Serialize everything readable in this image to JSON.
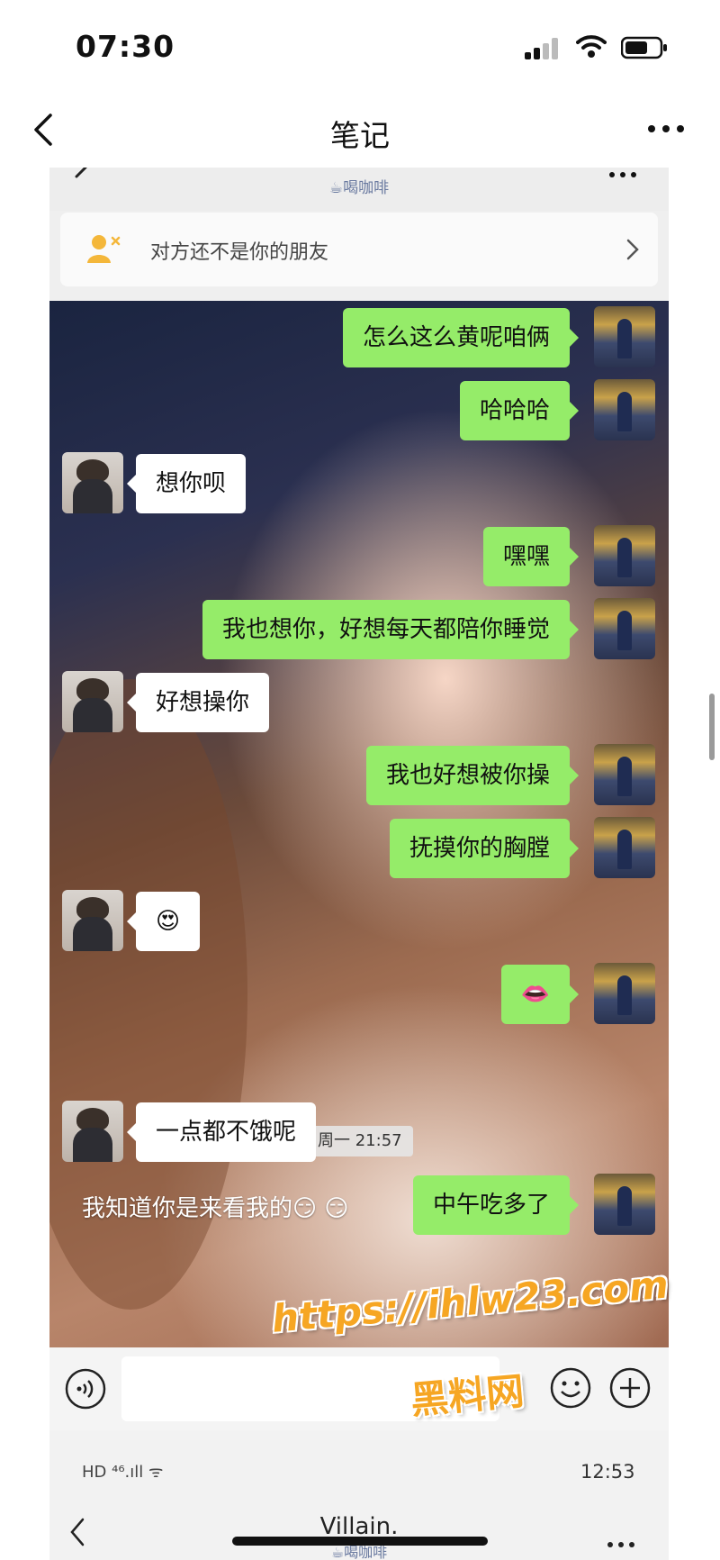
{
  "status_bar": {
    "time": "07:30"
  },
  "nav": {
    "title": "笔记"
  },
  "screenshot": {
    "subtitle": "☕喝咖啡",
    "friend_notice": "对方还不是你的朋友",
    "messages": [
      {
        "side": "me",
        "text": "怎么这么黄呢咱俩"
      },
      {
        "side": "me",
        "text": "哈哈哈"
      },
      {
        "side": "other",
        "text": "想你呗"
      },
      {
        "side": "me",
        "text": "嘿嘿"
      },
      {
        "side": "me",
        "text": "我也想你，好想每天都陪你睡觉"
      },
      {
        "side": "other",
        "text": "好想操你"
      },
      {
        "side": "me",
        "text": "我也好想被你操"
      },
      {
        "side": "me",
        "text": "抚摸你的胸膛"
      },
      {
        "side": "other",
        "text": "😍"
      },
      {
        "side": "me",
        "text": "👄"
      },
      {
        "side": "other",
        "text": "一点都不饿呢"
      },
      {
        "side": "me",
        "text": "中午吃多了"
      }
    ],
    "timestamp": "周一 21:57",
    "overlay_caption": "我知道你是来看我的😏 😏"
  },
  "second_screenshot": {
    "status_left": "HD ⁴⁶.ıll ᯤ",
    "time": "12:53",
    "title": "Villain.",
    "subtitle": "☕喝咖啡"
  },
  "watermark": {
    "url": "https://ihlw23.com",
    "brand": "黑料网"
  },
  "colors": {
    "bubble_me": "#95ec69",
    "bubble_other": "#ffffff",
    "watermark": "#f6a623"
  }
}
